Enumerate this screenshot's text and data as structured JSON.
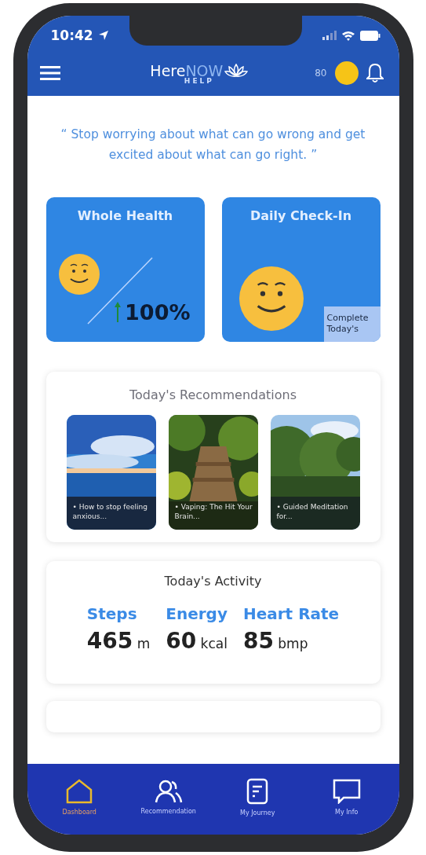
{
  "status_bar": {
    "time": "10:42"
  },
  "header": {
    "logo": {
      "here": "Here",
      "now": "NOW",
      "sub": "HELP"
    },
    "points": "80"
  },
  "quote": "“ Stop worrying about what can go wrong and get excited about what can go right. ”",
  "tiles": [
    {
      "kind": "trend",
      "title": "Whole Health",
      "value": "100%"
    },
    {
      "kind": "checkin",
      "title": "Daily Check-In",
      "button": "Complete Today's"
    }
  ],
  "recommendations": {
    "title": "Today's Recommendations",
    "items": [
      {
        "caption": "• How to stop feeling anxious..."
      },
      {
        "caption": "• Vaping: The Hit Your Brain..."
      },
      {
        "caption": "• Guided Meditation for..."
      }
    ]
  },
  "activity": {
    "title": "Today's Activity",
    "metrics": [
      {
        "label": "Steps",
        "value": "465",
        "unit": "m"
      },
      {
        "label": "Energy",
        "value": "60",
        "unit": "kcal"
      },
      {
        "label": "Heart Rate",
        "value": "85",
        "unit": "bmp"
      }
    ]
  },
  "nav": [
    {
      "label": "Dashboard",
      "selected": true
    },
    {
      "label": "Recommendation",
      "selected": false
    },
    {
      "label": "My Journey",
      "selected": false
    },
    {
      "label": "My Info",
      "selected": false
    }
  ]
}
